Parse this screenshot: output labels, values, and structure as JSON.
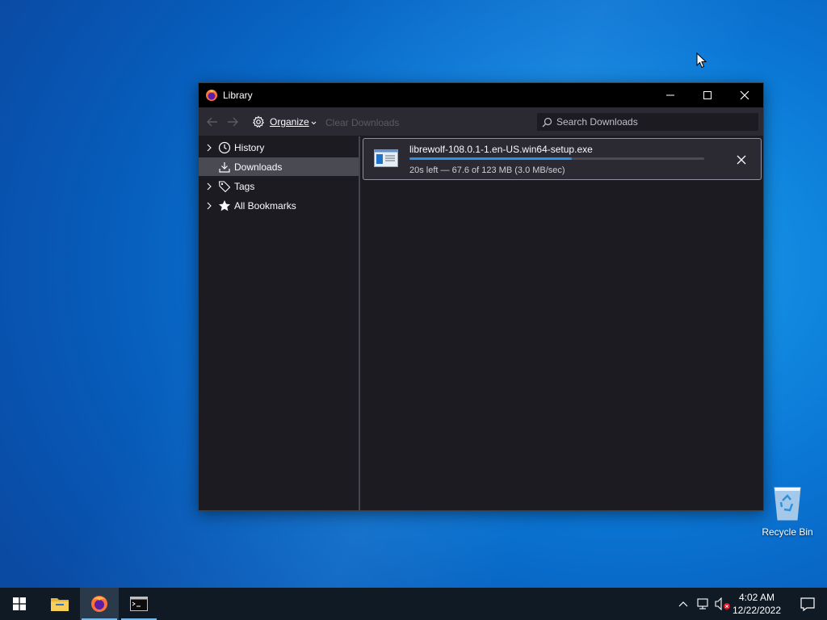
{
  "window": {
    "title": "Library",
    "icon": "librewolf-icon",
    "controls": [
      "minimize-icon",
      "maximize-icon",
      "close-icon"
    ]
  },
  "toolbar": {
    "back_icon": "arrow-left-icon",
    "forward_icon": "arrow-right-icon",
    "organize_label": "Organize",
    "organize_icon": "gear-icon",
    "clear_downloads_label": "Clear Downloads",
    "search_placeholder": "Search Downloads",
    "search_value": ""
  },
  "sidebar": {
    "items": [
      {
        "label": "History",
        "icon": "clock-icon",
        "expandable": true,
        "selected": false
      },
      {
        "label": "Downloads",
        "icon": "download-icon",
        "expandable": false,
        "selected": true
      },
      {
        "label": "Tags",
        "icon": "tag-icon",
        "expandable": true,
        "selected": false
      },
      {
        "label": "All Bookmarks",
        "icon": "star-icon",
        "expandable": true,
        "selected": false
      }
    ]
  },
  "downloads": [
    {
      "filename": "librewolf-108.0.1-1.en-US.win64-setup.exe",
      "status": "20s left — 67.6 of 123 MB (3.0 MB/sec)",
      "progress": 0.55,
      "icon": "installer-file-icon",
      "action_icon": "cancel-icon"
    }
  ],
  "desktop": {
    "recycle_bin_label": "Recycle Bin"
  },
  "taskbar": {
    "apps": [
      "windows-start-icon",
      "file-explorer-icon",
      "librewolf-icon",
      "terminal-icon"
    ],
    "active_app": "librewolf-icon",
    "tray_icons": [
      "chevron-up-icon",
      "network-icon",
      "volume-muted-icon"
    ],
    "time": "4:02 AM",
    "date": "12/22/2022",
    "notification_icon": "notification-icon"
  },
  "colors": {
    "accent": "#2893e8",
    "window_bg": "#1c1b22",
    "toolbar_bg": "#2b2a33",
    "titlebar_bg": "#000000",
    "taskbar_bg": "#101a24"
  }
}
